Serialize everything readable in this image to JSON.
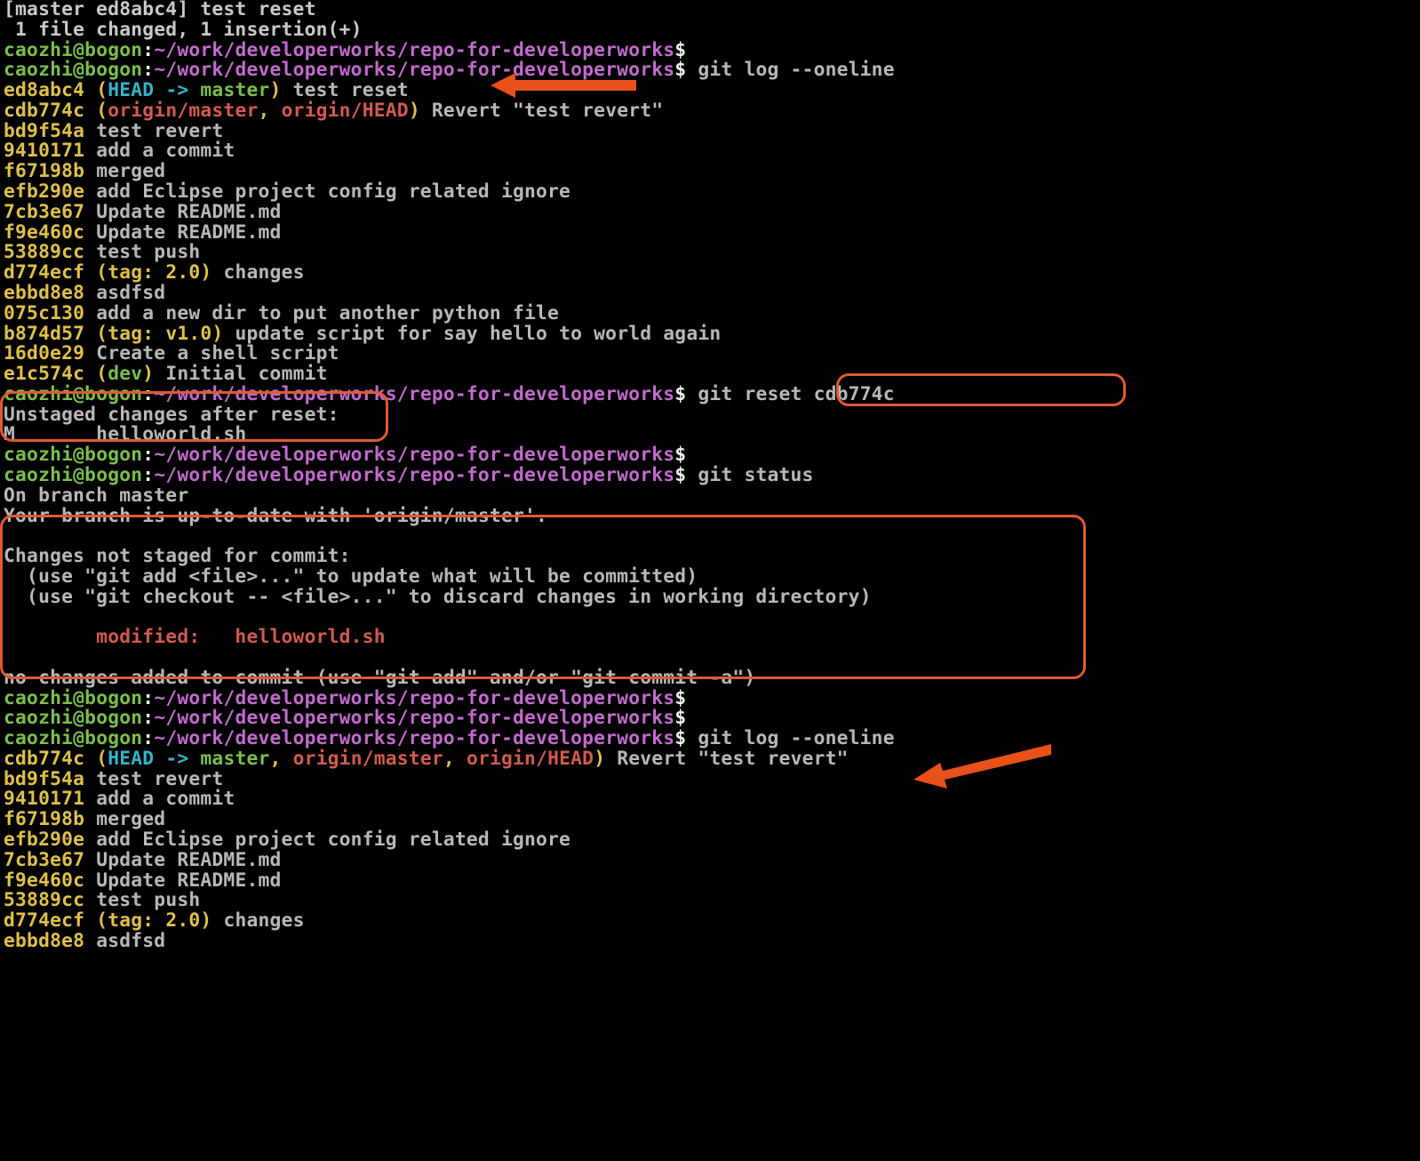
{
  "prompt": {
    "user": "caozhi",
    "host": "bogon",
    "path": "~/work/developerworks/repo-for-developerworks",
    "sep": "$"
  },
  "top_commit_out": {
    "line1": "[master ed8abc4] test reset",
    "line2": " 1 file changed, 1 insertion(+)"
  },
  "cmd_gitlog": "git log --oneline",
  "cmd_gitreset": "git reset cdb774c",
  "cmd_gitstatus": "git status",
  "log1": [
    {
      "hash": "ed8abc4",
      "refs": "(HEAD -> master)",
      "refparts": {
        "open": "(",
        "head": "HEAD -> ",
        "master": "master",
        "close": ")"
      },
      "msg": " test reset"
    },
    {
      "hash": "cdb774c",
      "refs": "(origin/master, origin/HEAD)",
      "refparts": {
        "open": "(",
        "r1": "origin/master",
        "c": ", ",
        "r2": "origin/HEAD",
        "close": ")"
      },
      "msg": " Revert \"test revert\""
    },
    {
      "hash": "bd9f54a",
      "msg": "test revert"
    },
    {
      "hash": "9410171",
      "msg": "add a commit"
    },
    {
      "hash": "f67198b",
      "msg": "merged"
    },
    {
      "hash": "efb290e",
      "msg": "add Eclipse project config related ignore"
    },
    {
      "hash": "7cb3e67",
      "msg": "Update README.md"
    },
    {
      "hash": "f9e460c",
      "msg": "Update README.md"
    },
    {
      "hash": "53889cc",
      "msg": "test push"
    },
    {
      "hash": "d774ecf",
      "refs": "(tag: 2.0)",
      "refparts": {
        "open": "(",
        "t": "tag: 2.0",
        "close": ")"
      },
      "msg": " changes"
    },
    {
      "hash": "ebbd8e8",
      "msg": "asdfsd"
    },
    {
      "hash": "075c130",
      "msg": "add a new dir to put another python file"
    },
    {
      "hash": "b874d57",
      "refs": "(tag: v1.0)",
      "refparts": {
        "open": "(",
        "t": "tag: v1.0",
        "close": ")"
      },
      "msg": " update script for say hello to world again"
    },
    {
      "hash": "16d0e29",
      "msg": "Create a shell script"
    },
    {
      "hash": "e1c574c",
      "refs": "(dev)",
      "refparts": {
        "open": "(",
        "d": "dev",
        "close": ")"
      },
      "msg": " Initial commit"
    }
  ],
  "reset_out": {
    "l1": "Unstaged changes after reset:",
    "l2": "M       helloworld.sh"
  },
  "status_out": {
    "l1": "On branch master",
    "l2": "Your branch is up-to-date with 'origin/master'.",
    "l3": "",
    "l4": "Changes not staged for commit:",
    "l5": "  (use \"git add <file>...\" to update what will be committed)",
    "l6": "  (use \"git checkout -- <file>...\" to discard changes in working directory)",
    "l7": "",
    "l8": "        modified:   helloworld.sh",
    "l9": "",
    "l10": "no changes added to commit (use \"git add\" and/or \"git commit -a\")"
  },
  "log2": [
    {
      "hash": "cdb774c",
      "refparts": {
        "open": "(",
        "head": "HEAD -> ",
        "master": "master",
        "c1": ", ",
        "r1": "origin/master",
        "c2": ", ",
        "r2": "origin/HEAD",
        "close": ")"
      },
      "msg": " Revert \"test revert\""
    },
    {
      "hash": "bd9f54a",
      "msg": "test revert"
    },
    {
      "hash": "9410171",
      "msg": "add a commit"
    },
    {
      "hash": "f67198b",
      "msg": "merged"
    },
    {
      "hash": "efb290e",
      "msg": "add Eclipse project config related ignore"
    },
    {
      "hash": "7cb3e67",
      "msg": "Update README.md"
    },
    {
      "hash": "f9e460c",
      "msg": "Update README.md"
    },
    {
      "hash": "53889cc",
      "msg": "test push"
    },
    {
      "hash": "d774ecf",
      "refparts": {
        "open": "(",
        "t": "tag: 2.0",
        "close": ")"
      },
      "msg": " changes"
    },
    {
      "hash": "ebbd8e8",
      "msg": "asdfsd"
    }
  ]
}
